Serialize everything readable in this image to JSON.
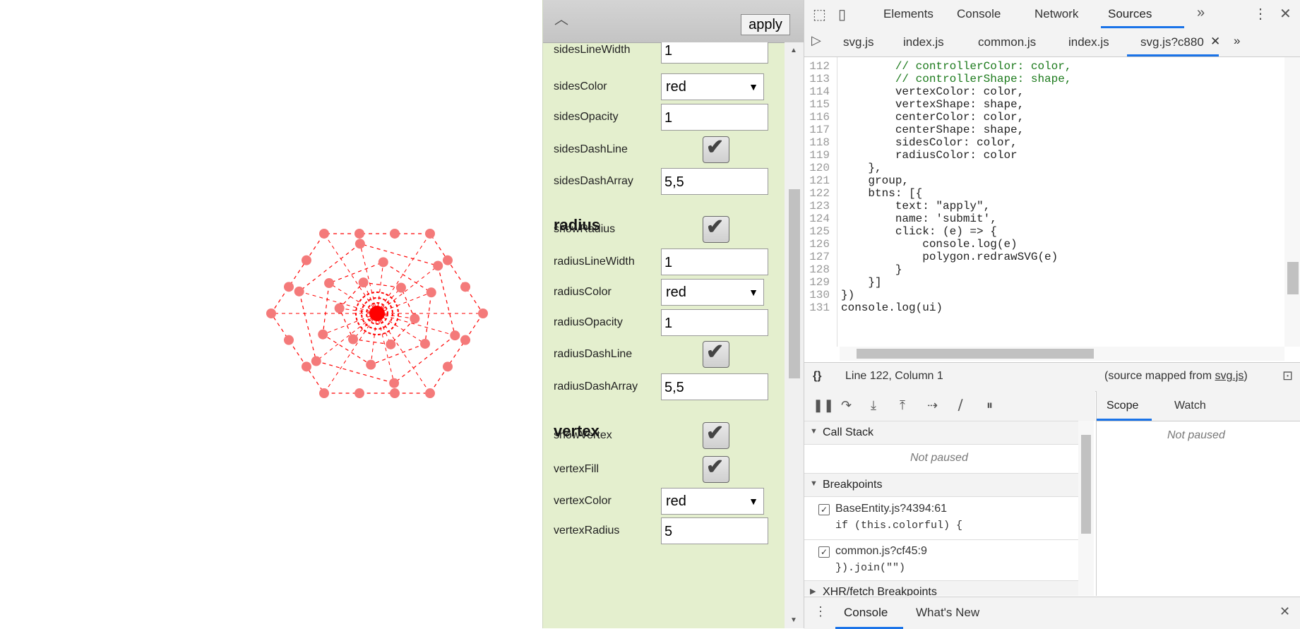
{
  "controller": {
    "apply_label": "apply",
    "rows": [
      {
        "kind": "text",
        "label": "sidesLineWidth",
        "value": "1"
      },
      {
        "kind": "select",
        "label": "sidesColor",
        "value": "red"
      },
      {
        "kind": "text",
        "label": "sidesOpacity",
        "value": "1"
      },
      {
        "kind": "check",
        "label": "sidesDashLine",
        "checked": true
      },
      {
        "kind": "text",
        "label": "sidesDashArray",
        "value": "5,5"
      },
      {
        "kind": "section",
        "label": "radius"
      },
      {
        "kind": "check",
        "label": "showRadius",
        "checked": true
      },
      {
        "kind": "text",
        "label": "radiusLineWidth",
        "value": "1"
      },
      {
        "kind": "select",
        "label": "radiusColor",
        "value": "red"
      },
      {
        "kind": "text",
        "label": "radiusOpacity",
        "value": "1"
      },
      {
        "kind": "check",
        "label": "radiusDashLine",
        "checked": true
      },
      {
        "kind": "text",
        "label": "radiusDashArray",
        "value": "5,5"
      },
      {
        "kind": "section",
        "label": "vertex"
      },
      {
        "kind": "check",
        "label": "showVertex",
        "checked": true
      },
      {
        "kind": "check",
        "label": "vertexFill",
        "checked": true
      },
      {
        "kind": "select",
        "label": "vertexColor",
        "value": "red"
      },
      {
        "kind": "text",
        "label": "vertexRadius",
        "value": "5"
      }
    ]
  },
  "devtools": {
    "main_tabs": [
      "Elements",
      "Console",
      "Network",
      "Sources"
    ],
    "active_main_tab": "Sources",
    "more_tabs_glyph": "»",
    "file_tabs": [
      "svg.js",
      "index.js",
      "common.js",
      "index.js",
      "svg.js?c880"
    ],
    "active_file_tab": "svg.js?c880",
    "code_lines": [
      {
        "n": "112",
        "text": "        // controllerColor: color,",
        "kind": "comment"
      },
      {
        "n": "113",
        "text": "        // controllerShape: shape,",
        "kind": "comment"
      },
      {
        "n": "114",
        "text": "        vertexColor: color,",
        "kind": "code"
      },
      {
        "n": "115",
        "text": "        vertexShape: shape,",
        "kind": "code"
      },
      {
        "n": "116",
        "text": "        centerColor: color,",
        "kind": "code"
      },
      {
        "n": "117",
        "text": "        centerShape: shape,",
        "kind": "code"
      },
      {
        "n": "118",
        "text": "        sidesColor: color,",
        "kind": "code"
      },
      {
        "n": "119",
        "text": "        radiusColor: color",
        "kind": "code"
      },
      {
        "n": "120",
        "text": "    },",
        "kind": "code"
      },
      {
        "n": "121",
        "text": "    group,",
        "kind": "code"
      },
      {
        "n": "122",
        "text": "    btns: [{",
        "kind": "code"
      },
      {
        "n": "123",
        "text": "        text: \"apply\",",
        "kind": "code"
      },
      {
        "n": "124",
        "text": "        name: 'submit',",
        "kind": "code"
      },
      {
        "n": "125",
        "text": "        click: (e) => {",
        "kind": "code"
      },
      {
        "n": "126",
        "text": "            console.log(e)",
        "kind": "code"
      },
      {
        "n": "127",
        "text": "            polygon.redrawSVG(e)",
        "kind": "code"
      },
      {
        "n": "128",
        "text": "        }",
        "kind": "code"
      },
      {
        "n": "129",
        "text": "    }]",
        "kind": "code"
      },
      {
        "n": "130",
        "text": "})",
        "kind": "code"
      },
      {
        "n": "131",
        "text": "console.log(ui)",
        "kind": "code"
      }
    ],
    "status": {
      "braces": "{}",
      "position": "Line 122, Column 1",
      "mapped_prefix": "(source mapped from ",
      "mapped_link": "svg.js",
      "mapped_suffix": ")"
    },
    "call_stack": {
      "title": "Call Stack",
      "empty": "Not paused"
    },
    "breakpoints": {
      "title": "Breakpoints",
      "items": [
        {
          "file": "BaseEntity.js?4394:61",
          "code": "if (this.colorful) {",
          "checked": true
        },
        {
          "file": "common.js?cf45:9",
          "code": "}).join(\"\")",
          "checked": true
        }
      ]
    },
    "xhr_title": "XHR/fetch Breakpoints",
    "scope_tabs": [
      "Scope",
      "Watch"
    ],
    "active_scope_tab": "Scope",
    "scope_empty": "Not paused",
    "drawer_tabs": [
      "Console",
      "What's New"
    ],
    "active_drawer_tab": "Console"
  },
  "colors": {
    "accent": "#1a73e8",
    "shape_red": "#ff0000",
    "vertex_fill": "#f47a7a",
    "comment": "#1c7a1c",
    "string": "#c41a16",
    "panel_bg": "#e4efce"
  },
  "icons": [
    "inspect-icon",
    "device-toggle-icon",
    "more-tabs-icon",
    "kebab-menu-icon",
    "close-icon",
    "navigator-toggle-icon",
    "pretty-print-icon",
    "pause-icon",
    "step-over-icon",
    "step-into-icon",
    "step-out-icon",
    "step-icon",
    "deactivate-breakpoints-icon",
    "pause-on-exceptions-icon"
  ]
}
